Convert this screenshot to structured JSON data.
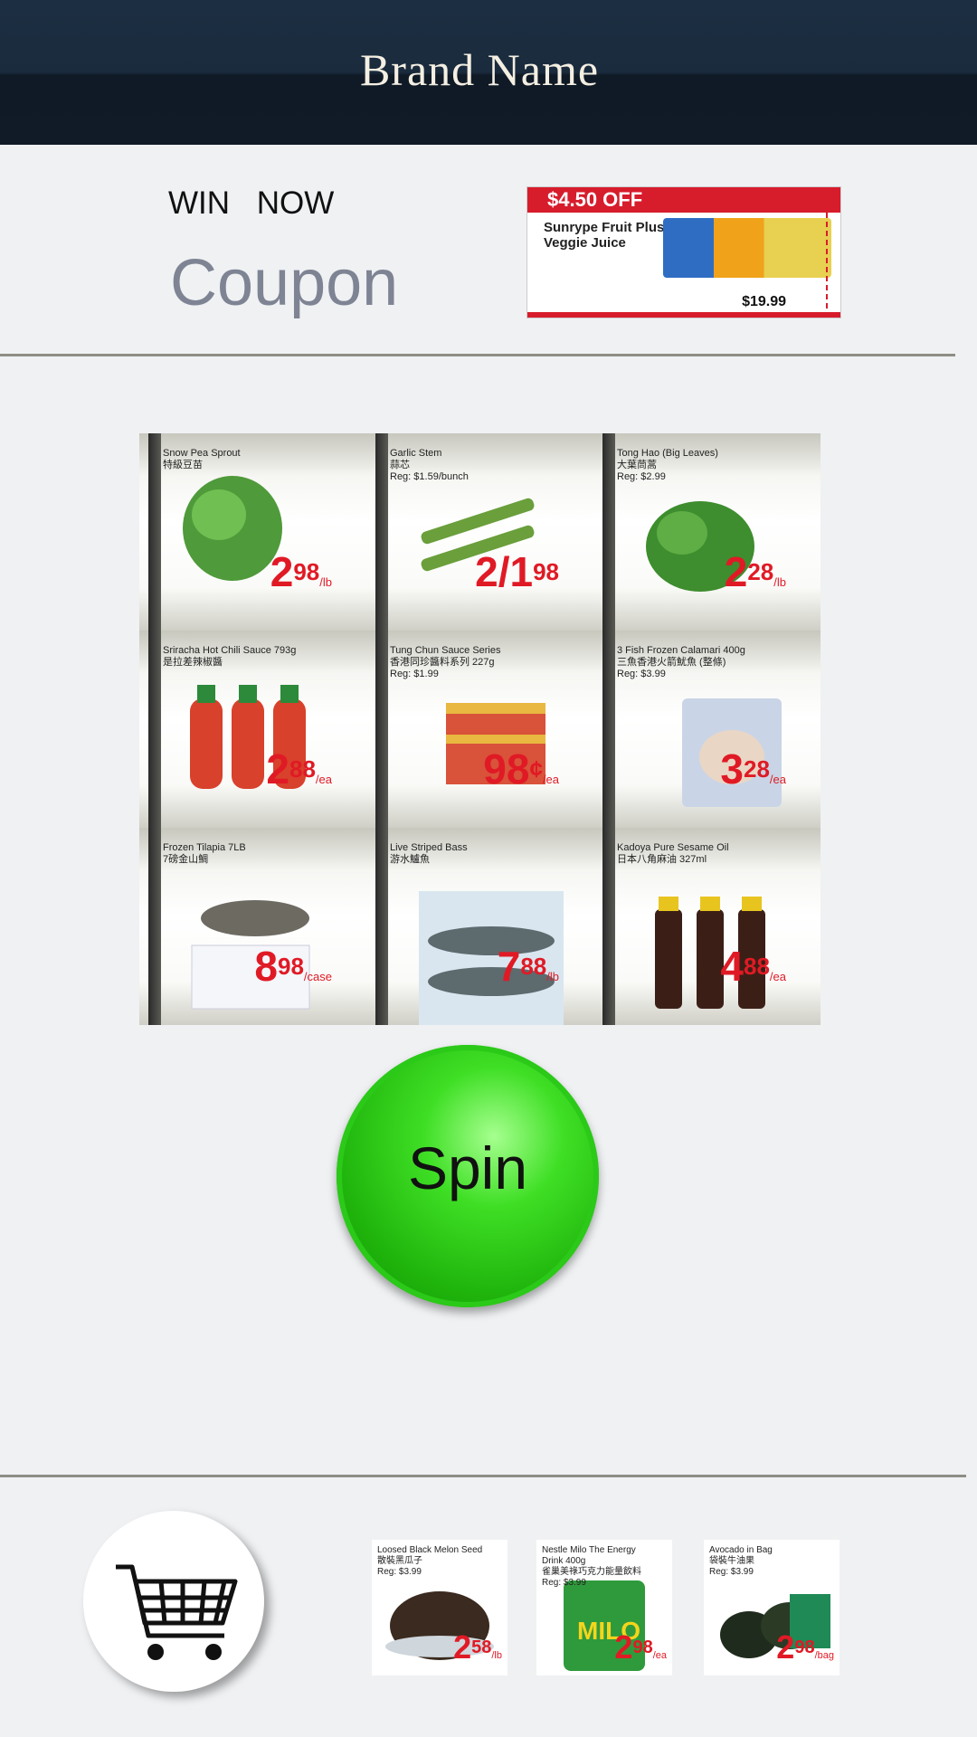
{
  "header": {
    "brand": "Brand Name"
  },
  "promo_area": {
    "win_label": "WIN   NOW",
    "coupon_label": "Coupon",
    "coupon_card": {
      "offer": "$4.50 OFF",
      "product": "Sunrype Fruit Plus Veggie Juice",
      "price": "$19.99"
    }
  },
  "slot_grid": [
    {
      "name": "Snow Pea Sprout\n特級豆苗",
      "price_main": "2",
      "price_cents": "98",
      "unit": "/lb"
    },
    {
      "name": "Garlic Stem\n蒜芯\nReg: $1.59/bunch",
      "price_main": "2/1",
      "price_cents": "98",
      "unit": ""
    },
    {
      "name": "Tong Hao (Big Leaves)\n大葉茼蒿\nReg: $2.99",
      "price_main": "2",
      "price_cents": "28",
      "unit": "/lb"
    },
    {
      "name": "Sriracha Hot Chili Sauce 793g\n是拉差辣椒醬",
      "price_main": "2",
      "price_cents": "88",
      "unit": "/ea"
    },
    {
      "name": "Tung Chun Sauce Series\n香港同珍醬料系列 227g\nReg: $1.99",
      "price_main": "98",
      "price_cents": "¢",
      "unit": "/ea"
    },
    {
      "name": "3 Fish Frozen Calamari 400g\n三魚香港火箭魷魚 (整條)\nReg: $3.99",
      "price_main": "3",
      "price_cents": "28",
      "unit": "/ea"
    },
    {
      "name": "Frozen Tilapia 7LB\n7磅金山鯛",
      "price_main": "8",
      "price_cents": "98",
      "unit": "/case"
    },
    {
      "name": "Live Striped Bass\n游水鱸魚",
      "price_main": "7",
      "price_cents": "88",
      "unit": "/lb"
    },
    {
      "name": "Kadoya Pure Sesame Oil\n日本八角麻油 327ml",
      "price_main": "4",
      "price_cents": "88",
      "unit": "/ea"
    }
  ],
  "spin_button": {
    "label": "Spin"
  },
  "bottom_products": [
    {
      "name": "Loosed Black Melon Seed\n散裝黑瓜子\nReg: $3.99",
      "price_main": "2",
      "price_cents": "58",
      "unit": "/lb"
    },
    {
      "name": "Nestle Milo The Energy\nDrink 400g\n雀巢美祿巧克力能量飲料\nReg: $3.99",
      "price_main": "2",
      "price_cents": "98",
      "unit": "/ea"
    },
    {
      "name": "Avocado in Bag\n袋裝牛油果\nReg: $3.99",
      "price_main": "2",
      "price_cents": "98",
      "unit": "/bag"
    }
  ]
}
